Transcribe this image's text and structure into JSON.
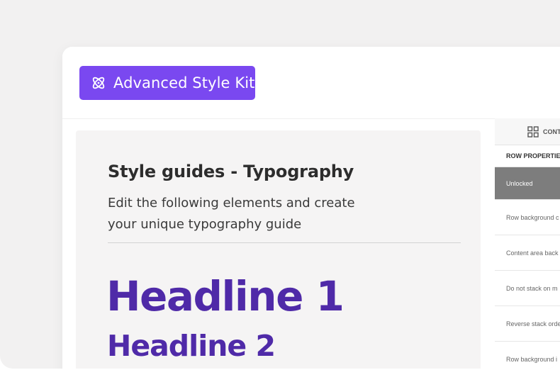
{
  "badge": {
    "label": "Advanced Style Kit",
    "icon": "atom-icon",
    "color": "#7a48f0"
  },
  "document": {
    "title": "Style guides - Typography",
    "subtitle_line1": "Edit the following elements and create",
    "subtitle_line2": "your unique typography guide",
    "headline1": "Headline 1",
    "headline2": "Headline 2",
    "headline_color": "#4f2aa8"
  },
  "sidebar": {
    "tab_label": "CONT",
    "tab_icon": "grid-icon",
    "section_label": "ROW PROPERTIES",
    "rows": [
      "Unlocked",
      "Row background c",
      "Content area back",
      "Do not stack on m",
      "Reverse stack orde",
      "Row background i"
    ]
  }
}
